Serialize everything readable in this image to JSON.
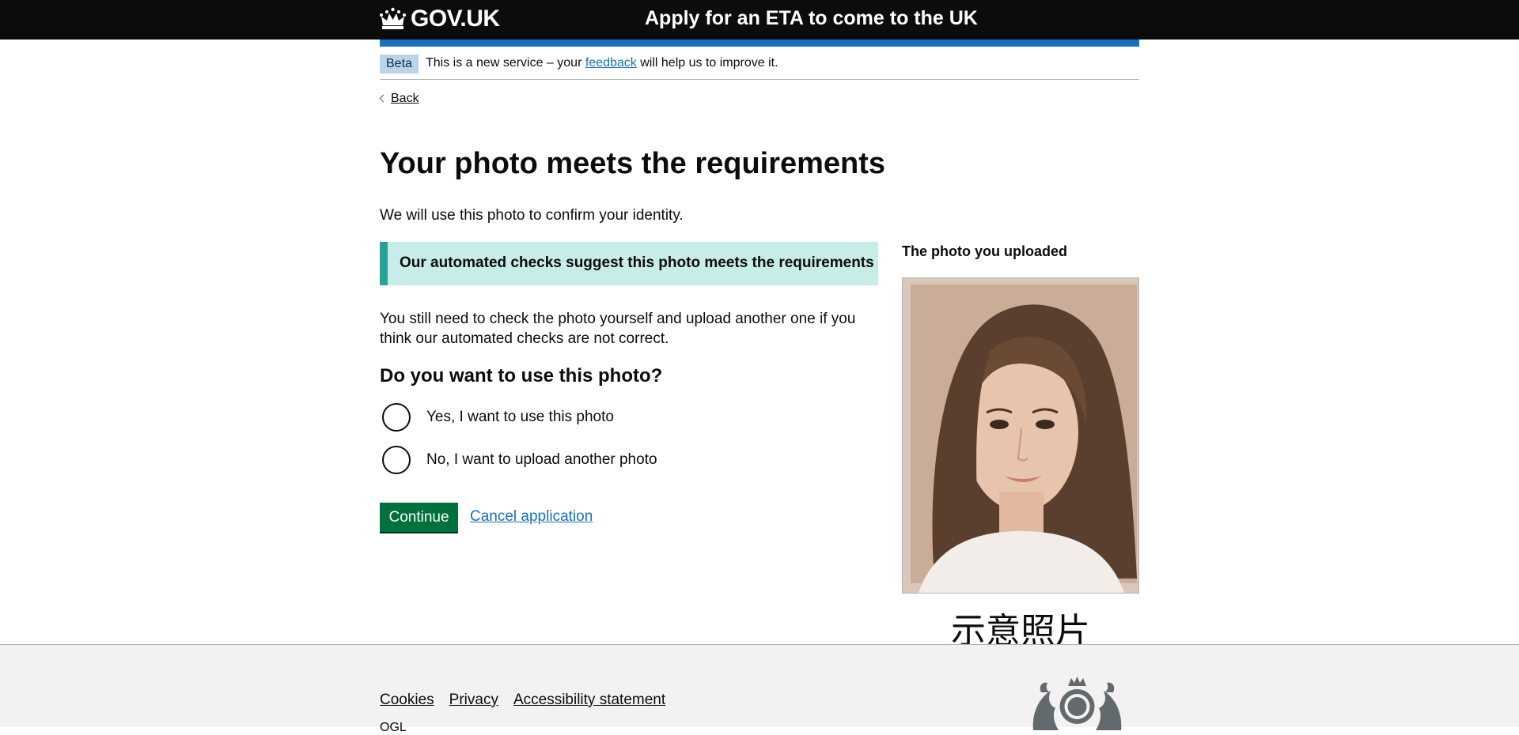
{
  "header": {
    "logo_text": "GOV.UK",
    "service_name": "Apply for an ETA to come to the UK"
  },
  "phase_banner": {
    "tag": "Beta",
    "text_before": "This is a new service – your ",
    "link": "feedback",
    "text_after": " will help us to improve it."
  },
  "back_link": "Back",
  "main": {
    "title": "Your photo meets the requirements",
    "lead": "We will use this photo to confirm your identity.",
    "inset": "Our automated checks suggest this photo meets the requirements",
    "body": "You still need to check the photo yourself and upload another one if you think our automated checks are not correct.",
    "question": "Do you want to use this photo?",
    "options": [
      {
        "label": "Yes, I want to use this photo",
        "selected": false
      },
      {
        "label": "No, I want to upload another photo",
        "selected": false
      }
    ],
    "continue_label": "Continue",
    "cancel_label": "Cancel application"
  },
  "photo": {
    "heading": "The photo you uploaded",
    "caption": "示意照片"
  },
  "footer": {
    "links": [
      "Cookies",
      "Privacy",
      "Accessibility statement"
    ],
    "partial_text": "OGL"
  },
  "colors": {
    "header_bg": "#0b0c0c",
    "accent_blue": "#1d70b8",
    "button_green": "#00703c",
    "inset_bg": "#c8ece7",
    "inset_border": "#28a197",
    "footer_bg": "#f3f2f1"
  }
}
